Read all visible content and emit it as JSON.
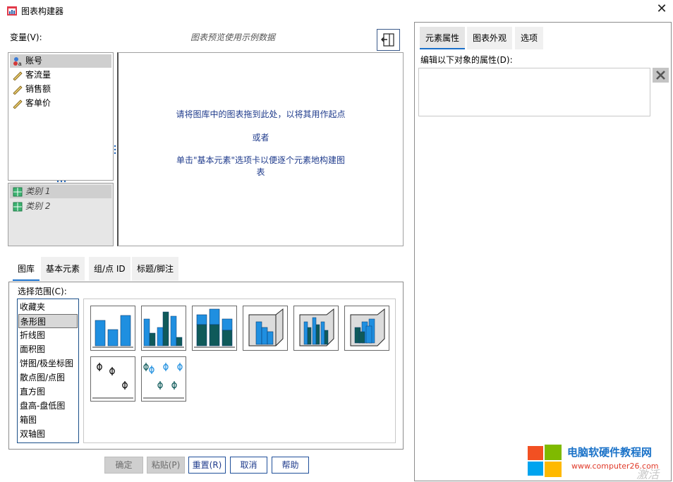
{
  "window": {
    "title": "图表构建器",
    "close_glyph": "✕"
  },
  "variables": {
    "label": "变量(V):",
    "items": [
      {
        "label": "账号",
        "icon": "nominal-string-icon"
      },
      {
        "label": "客流量",
        "icon": "scale-ruler-icon"
      },
      {
        "label": "销售额",
        "icon": "scale-ruler-icon"
      },
      {
        "label": "客单价",
        "icon": "scale-ruler-icon"
      }
    ],
    "categories": [
      {
        "label": "类别 1",
        "icon": "category-grid-icon"
      },
      {
        "label": "类别 2",
        "icon": "category-grid-icon"
      }
    ]
  },
  "preview": {
    "note": "图表预览使用示例数据",
    "message_line1": "请将图库中的图表拖到此处，以将其用作起点",
    "message_or": "或者",
    "message_line3a": "单击\"基本元素\"选项卡以便逐个元素地构建图",
    "message_line3b": "表"
  },
  "bottom_tabs": [
    "图库",
    "基本元素",
    "组/点 ID",
    "标题/脚注"
  ],
  "gallery": {
    "range_label": "选择范围(C):",
    "chart_types": [
      "收藏夹",
      "条形图",
      "折线图",
      "面积图",
      "饼图/极坐标图",
      "散点图/点图",
      "直方图",
      "盘高-盘低图",
      "箱图",
      "双轴图"
    ],
    "selected_index": 1
  },
  "buttons": {
    "ok": "确定",
    "paste": "粘贴(P)",
    "reset": "重置(R)",
    "cancel": "取消",
    "help": "帮助"
  },
  "right_panel": {
    "tabs": [
      "元素属性",
      "图表外观",
      "选项"
    ],
    "props_label": "编辑以下对象的属性(D):",
    "delete_glyph": "✕"
  },
  "watermark": {
    "site_name": "电脑软硬件教程网",
    "url": "www.computer26.com",
    "activate": "激活"
  },
  "colors": {
    "bar_light": "#1f8fe0",
    "bar_dark": "#0f5a5a",
    "accent_tab": "#1a6fc9",
    "message_text": "#1f3b8c"
  }
}
